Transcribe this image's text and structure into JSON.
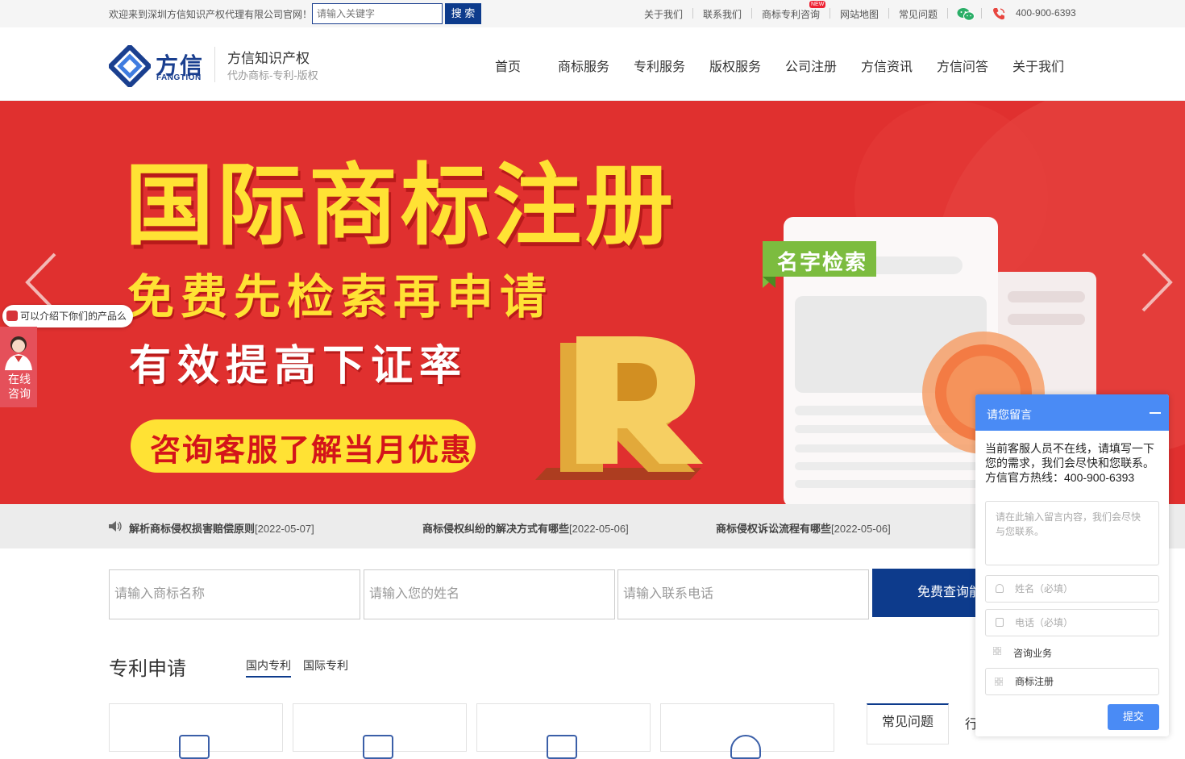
{
  "topbar": {
    "welcome": "欢迎来到深圳方信知识产权代理有限公司官网！",
    "search_placeholder": "请输入关键字",
    "search_button": "搜 索",
    "links": [
      "关于我们",
      "联系我们",
      "商标专利咨询",
      "网站地图",
      "常见问题"
    ],
    "new_badge": "NEW",
    "phone": "400-900-6393"
  },
  "header": {
    "logo_cn": "方信",
    "logo_en": "FANGTION",
    "brand_title": "方信知识产权",
    "brand_sub": "代办商标-专利-版权",
    "nav": [
      "首页",
      "商标服务",
      "专利服务",
      "版权服务",
      "公司注册",
      "方信资讯",
      "方信问答",
      "关于我们"
    ]
  },
  "banner": {
    "title": "国际商标注册",
    "line1": "免费先检索再申请",
    "line2": "有效提高下证率",
    "pill": "咨询客服了解当月优惠",
    "tag": "名字检索",
    "letter": "R"
  },
  "ticker": [
    {
      "title": "解析商标侵权损害赔偿原则",
      "date": "[2022-05-07]"
    },
    {
      "title": "商标侵权纠纷的解决方式有哪些",
      "date": "[2022-05-06]"
    },
    {
      "title": "商标侵权诉讼流程有哪些",
      "date": "[2022-05-06]"
    }
  ],
  "query_form": {
    "trademark_placeholder": "请输入商标名称",
    "name_placeholder": "请输入您的姓名",
    "phone_placeholder": "请输入联系电话",
    "button": "免费查询能"
  },
  "patents": {
    "title": "专利申请",
    "tabs": [
      "国内专利",
      "国际专利"
    ],
    "faq_tabs": [
      "常见问题",
      "行"
    ]
  },
  "float": {
    "bubble": "可以介绍下你们的产品么",
    "consult": "在线咨询"
  },
  "message_panel": {
    "title": "请您留言",
    "message": "当前客服人员不在线，请填写一下您的需求，我们会尽快和您联系。方信官方热线：400-900-6393",
    "textarea_placeholder": "请在此输入留言内容，我们会尽快与您联系。",
    "name_placeholder": "姓名（必填）",
    "phone_placeholder": "电话（必填）",
    "business_label": "咨询业务",
    "business_value": "商标注册",
    "submit": "提交"
  },
  "colors": {
    "brand_blue": "#0d3b8c",
    "banner_red": "#e0302f",
    "banner_yellow": "#ffe234",
    "panel_blue": "#4a8bf5"
  }
}
